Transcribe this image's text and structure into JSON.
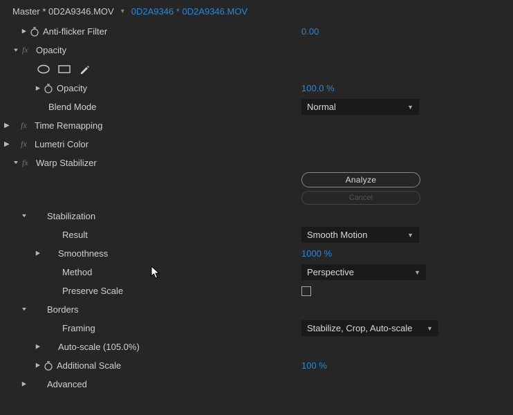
{
  "breadcrumb": {
    "master": "Master * 0D2A9346.MOV",
    "clip": "0D2A9346 * 0D2A9346.MOV"
  },
  "antiFlicker": {
    "label": "Anti-flicker Filter",
    "value": "0.00"
  },
  "opacity": {
    "group": "Opacity",
    "prop": "Opacity",
    "value": "100.0 %",
    "blendMode": {
      "label": "Blend Mode",
      "value": "Normal"
    }
  },
  "timeRemap": {
    "label": "Time Remapping"
  },
  "lumetri": {
    "label": "Lumetri Color"
  },
  "warp": {
    "label": "Warp Stabilizer",
    "analyze": "Analyze",
    "cancel": "Cancel",
    "stabilization": {
      "label": "Stabilization",
      "result": {
        "label": "Result",
        "value": "Smooth Motion"
      },
      "smoothness": {
        "label": "Smoothness",
        "value": "1000 %"
      },
      "method": {
        "label": "Method",
        "value": "Perspective"
      },
      "preserve": {
        "label": "Preserve Scale",
        "checked": false
      }
    },
    "borders": {
      "label": "Borders",
      "framing": {
        "label": "Framing",
        "value": "Stabilize, Crop, Auto-scale"
      },
      "autoScale": {
        "label": "Auto-scale (105.0%)"
      },
      "additionalScale": {
        "label": "Additional Scale",
        "value": "100 %"
      }
    },
    "advanced": {
      "label": "Advanced"
    }
  }
}
